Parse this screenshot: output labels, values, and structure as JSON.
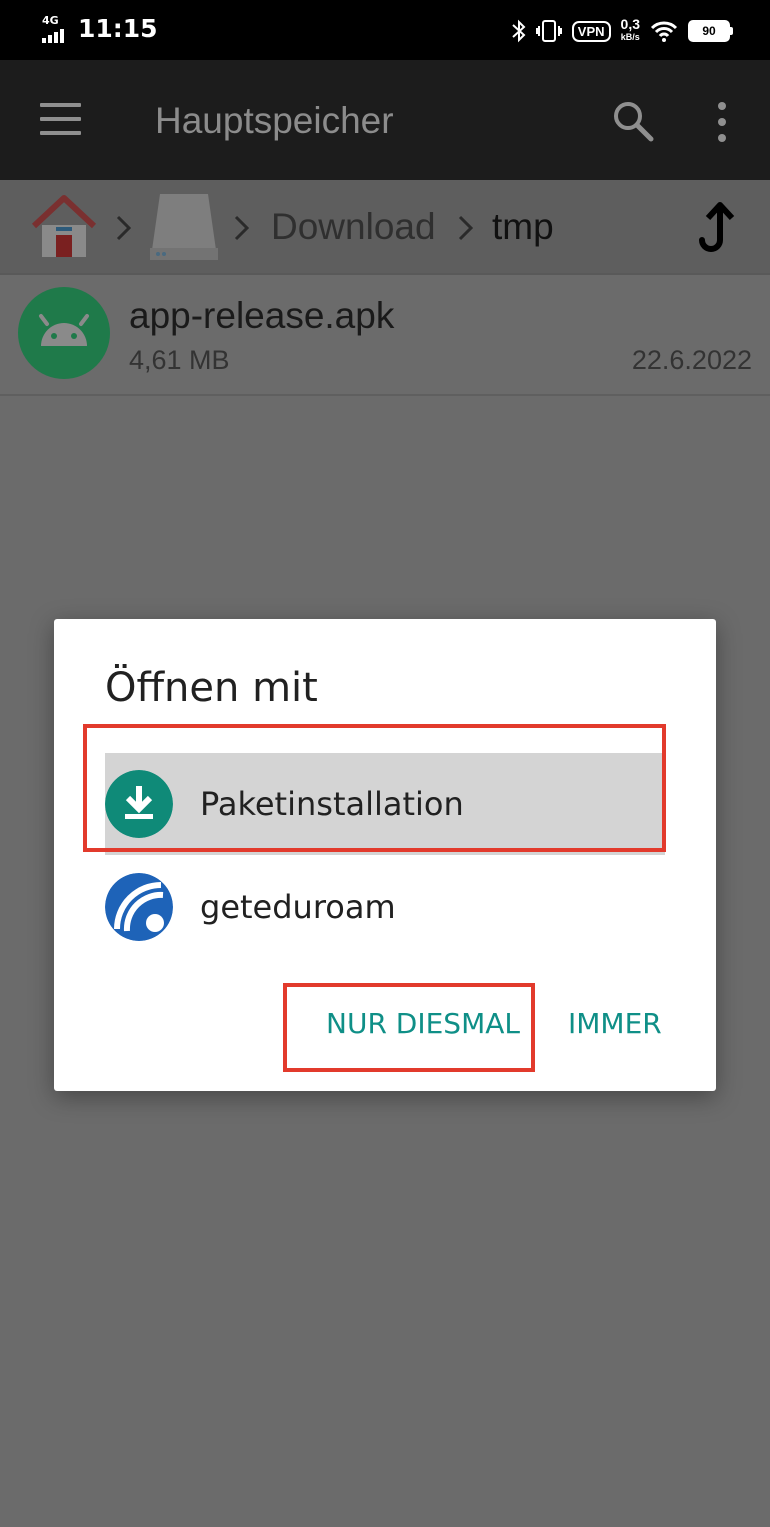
{
  "status_bar": {
    "network": "4G",
    "time": "11:15",
    "vpn": "VPN",
    "speed_value": "0,3",
    "speed_unit": "kB/s",
    "battery": "90"
  },
  "app_bar": {
    "title": "Hauptspeicher"
  },
  "breadcrumb": {
    "folder1": "Download",
    "folder2": "tmp"
  },
  "file": {
    "name": "app-release.apk",
    "size": "4,61 MB",
    "date": "22.6.2022"
  },
  "dialog": {
    "title": "Öffnen mit",
    "options": [
      {
        "label": "Paketinstallation",
        "icon": "download-icon",
        "selected": true
      },
      {
        "label": "geteduroam",
        "icon": "eduroam-icon",
        "selected": false
      }
    ],
    "just_once": "NUR DIESMAL",
    "always": "IMMER"
  },
  "colors": {
    "accent": "#0f8f87",
    "highlight": "#e23a2c",
    "android_green": "#1e9e58",
    "eduroam_blue": "#1e63b8"
  }
}
